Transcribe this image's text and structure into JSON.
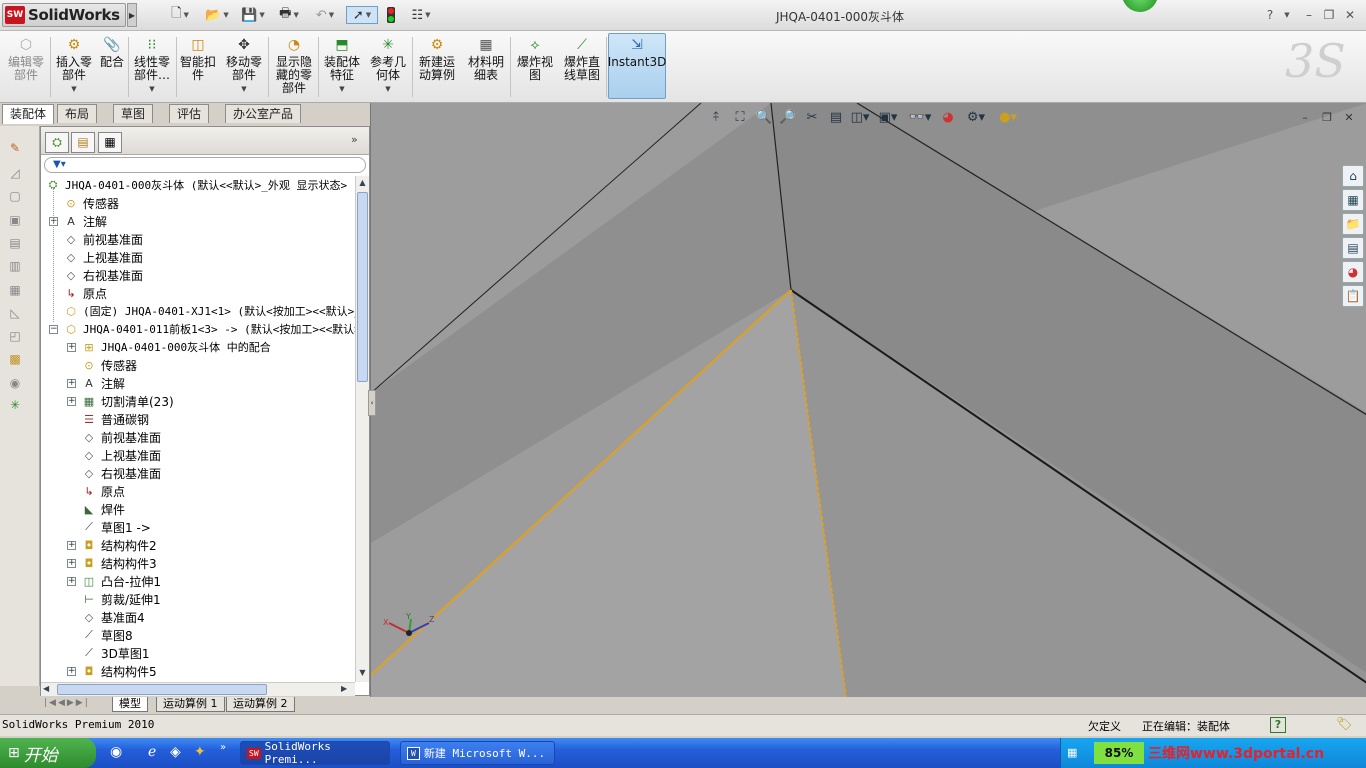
{
  "app": {
    "logo_text": "SolidWorks",
    "logo_badge": "SW",
    "document_title": "JHQA-0401-000灰斗体",
    "help_label": "?"
  },
  "ribbon": {
    "buttons": [
      {
        "label": "编辑零\n部件",
        "icon": "edit-component-icon",
        "disabled": true
      },
      {
        "label": "插入零\n部件",
        "icon": "insert-component-icon"
      },
      {
        "label": "配合",
        "icon": "mate-icon"
      },
      {
        "label": "线性零\n部件…",
        "icon": "linear-pattern-icon"
      },
      {
        "label": "智能扣\n件",
        "icon": "smart-fasteners-icon"
      },
      {
        "label": "移动零\n部件",
        "icon": "move-component-icon"
      },
      {
        "label": "显示隐\n藏的零\n部件",
        "icon": "show-hidden-icon"
      },
      {
        "label": "装配体\n特征",
        "icon": "assembly-features-icon"
      },
      {
        "label": "参考几\n何体",
        "icon": "reference-geometry-icon"
      },
      {
        "label": "新建运\n动算例",
        "icon": "new-motion-study-icon"
      },
      {
        "label": "材料明\n细表",
        "icon": "bom-icon"
      },
      {
        "label": "爆炸视\n图",
        "icon": "exploded-view-icon"
      },
      {
        "label": "爆炸直\n线草图",
        "icon": "explode-line-sketch-icon"
      },
      {
        "label": "Instant3D",
        "icon": "instant3d-icon",
        "active": true
      }
    ]
  },
  "command_tabs": [
    "装配体",
    "布局",
    "草图",
    "评估",
    "办公室产品"
  ],
  "feature_tree": {
    "root": "JHQA-0401-000灰斗体  (默认<<默认>_外观 显示状态>",
    "items": [
      {
        "text": "传感器",
        "icon": "sensor-icon",
        "expand": false,
        "level": 1
      },
      {
        "text": "注解",
        "icon": "annotation-icon",
        "expand": true,
        "level": 1
      },
      {
        "text": "前视基准面",
        "icon": "plane-icon",
        "expand": false,
        "level": 1
      },
      {
        "text": "上视基准面",
        "icon": "plane-icon",
        "expand": false,
        "level": 1
      },
      {
        "text": "右视基准面",
        "icon": "plane-icon",
        "expand": false,
        "level": 1
      },
      {
        "text": "原点",
        "icon": "origin-icon",
        "expand": false,
        "level": 1
      },
      {
        "text": "(固定) JHQA-0401-XJ1<1> (默认<按加工><<默认>_",
        "icon": "part-icon",
        "expand": false,
        "level": 1,
        "mono": true
      },
      {
        "text": "JHQA-0401-011前板1<3> -> (默认<按加工><<默认>",
        "icon": "part-icon",
        "expand": true,
        "expanded": true,
        "level": 1,
        "mono": true
      },
      {
        "text": "JHQA-0401-000灰斗体 中的配合",
        "icon": "mates-folder-icon",
        "expand": true,
        "level": 2,
        "mono": true
      },
      {
        "text": "传感器",
        "icon": "sensor-icon",
        "expand": false,
        "level": 2
      },
      {
        "text": "注解",
        "icon": "annotation-icon",
        "expand": true,
        "level": 2
      },
      {
        "text": "切割清单(23)",
        "icon": "cut-list-icon",
        "expand": true,
        "level": 2
      },
      {
        "text": "普通碳钢",
        "icon": "material-icon",
        "expand": false,
        "level": 2
      },
      {
        "text": "前视基准面",
        "icon": "plane-icon",
        "expand": false,
        "level": 2
      },
      {
        "text": "上视基准面",
        "icon": "plane-icon",
        "expand": false,
        "level": 2
      },
      {
        "text": "右视基准面",
        "icon": "plane-icon",
        "expand": false,
        "level": 2
      },
      {
        "text": "原点",
        "icon": "origin-icon",
        "expand": false,
        "level": 2
      },
      {
        "text": "焊件",
        "icon": "weldment-icon",
        "expand": false,
        "level": 2
      },
      {
        "text": "草图1 ->",
        "icon": "sketch-icon",
        "expand": false,
        "level": 2
      },
      {
        "text": "结构构件2",
        "icon": "structural-member-icon",
        "expand": true,
        "level": 2
      },
      {
        "text": "结构构件3",
        "icon": "structural-member-icon",
        "expand": true,
        "level": 2
      },
      {
        "text": "凸台-拉伸1",
        "icon": "extrude-icon",
        "expand": true,
        "level": 2
      },
      {
        "text": "剪裁/延伸1",
        "icon": "trim-extend-icon",
        "expand": false,
        "level": 2
      },
      {
        "text": "基准面4",
        "icon": "plane-icon",
        "expand": false,
        "level": 2
      },
      {
        "text": "草图8",
        "icon": "sketch-icon",
        "expand": false,
        "level": 2
      },
      {
        "text": "3D草图1",
        "icon": "sketch3d-icon",
        "expand": false,
        "level": 2
      },
      {
        "text": "结构构件5",
        "icon": "structural-member-icon",
        "expand": true,
        "level": 2
      }
    ]
  },
  "bottom_tabs": [
    "模型",
    "运动算例 1",
    "运动算例 2"
  ],
  "status": {
    "left": "SolidWorks Premium 2010",
    "state": "欠定义",
    "editing": "正在编辑：装配体",
    "help": "?"
  },
  "taskbar": {
    "start": "开始",
    "windows": [
      "SolidWorks Premi...",
      "新建 Microsoft W..."
    ],
    "zoom": "85%",
    "watermark": "三维网www.3dportal.cn"
  },
  "triad": {
    "x": "X",
    "y": "Y",
    "z": "Z"
  },
  "colors": {
    "viewport_bg": "#9c9c9c",
    "edge_highlight": "#e0a020",
    "taskbar": "#245edb",
    "start_button": "#3a9a3a"
  }
}
